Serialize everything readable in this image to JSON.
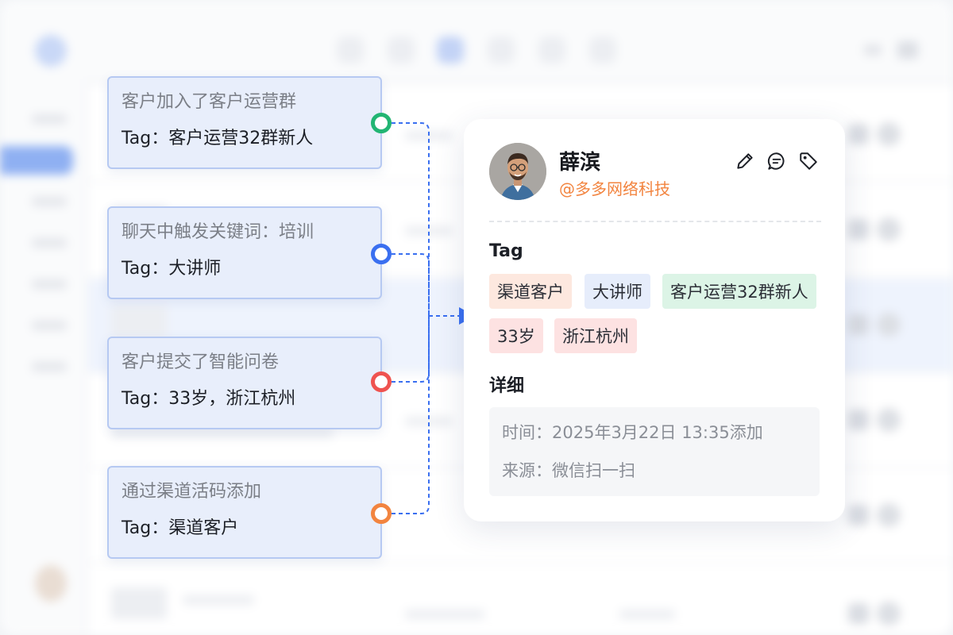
{
  "events": [
    {
      "title": "客户加入了客户运营群",
      "tag": "Tag：客户运营32群新人",
      "port_color": "#22b573"
    },
    {
      "title": "聊天中触发关键词：培训",
      "tag": "Tag：大讲师",
      "port_color": "#3a6ff0"
    },
    {
      "title": "客户提交了智能问卷",
      "tag": "Tag：33岁，浙江杭州",
      "port_color": "#ef5350"
    },
    {
      "title": "通过渠道活码添加",
      "tag": "Tag：渠道客户",
      "port_color": "#f2843f"
    }
  ],
  "profile": {
    "name": "薛滨",
    "company": "@多多网络科技",
    "actions": [
      {
        "icon": "pencil-icon"
      },
      {
        "icon": "message-icon"
      },
      {
        "icon": "tag-icon"
      }
    ],
    "tag_section_title": "Tag",
    "tags": [
      {
        "label": "渠道客户",
        "color": "#fde8df"
      },
      {
        "label": "大讲师",
        "color": "#e6edfb"
      },
      {
        "label": "客户运营32群新人",
        "color": "#dcf4e6"
      },
      {
        "label": "33岁",
        "color": "#fde2e2"
      },
      {
        "label": "浙江杭州",
        "color": "#fde2e2"
      }
    ],
    "detail_section_title": "详细",
    "detail": {
      "time": "时间：2025年3月22日 13:35添加",
      "source": "来源：微信扫一扫"
    }
  },
  "colors": {
    "accent": "#3a6ff0",
    "company": "#f2843f",
    "connector": "#3a6ff0"
  }
}
